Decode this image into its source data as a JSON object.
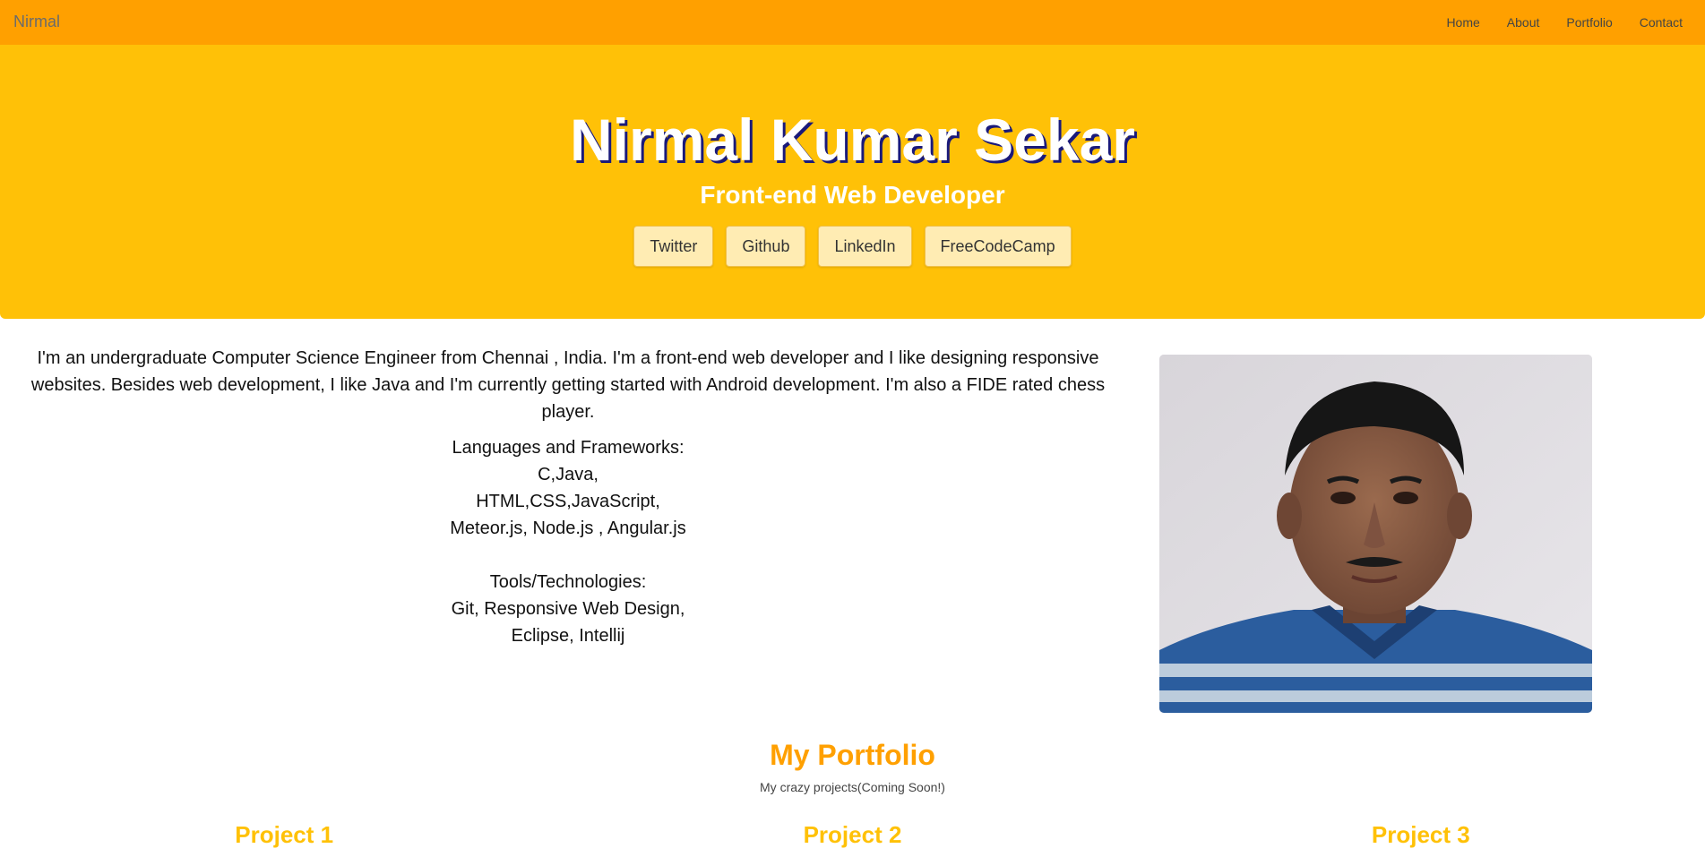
{
  "nav": {
    "brand": "Nirmal",
    "links": [
      "Home",
      "About",
      "Portfolio",
      "Contact"
    ]
  },
  "hero": {
    "title": "Nirmal Kumar Sekar",
    "subtitle": "Front-end Web Developer",
    "buttons": [
      "Twitter",
      "Github",
      "LinkedIn",
      "FreeCodeCamp"
    ]
  },
  "about": {
    "intro": "I'm an undergraduate Computer Science Engineer from Chennai , India. I'm a front-end web developer and I like designing responsive websites. Besides web development, I like Java and I'm currently getting started with Android development. I'm also a FIDE rated chess player.",
    "languages_heading": "Languages and Frameworks:",
    "languages": [
      "C,Java,",
      "HTML,CSS,JavaScript,",
      "Meteor.js, Node.js , Angular.js"
    ],
    "tools_heading": "Tools/Technologies:",
    "tools": [
      "Git, Responsive Web Design,",
      "Eclipse, Intellij"
    ]
  },
  "portfolio": {
    "title": "My Portfolio",
    "subtitle": "My crazy projects(Coming Soon!)",
    "projects": [
      "Project 1",
      "Project 2",
      "Project 3"
    ]
  },
  "colors": {
    "navbar": "#ffa000",
    "hero": "#ffc107",
    "button": "#ffecb3",
    "portfolio_title": "#ffa000",
    "project_title": "#ffc107"
  }
}
